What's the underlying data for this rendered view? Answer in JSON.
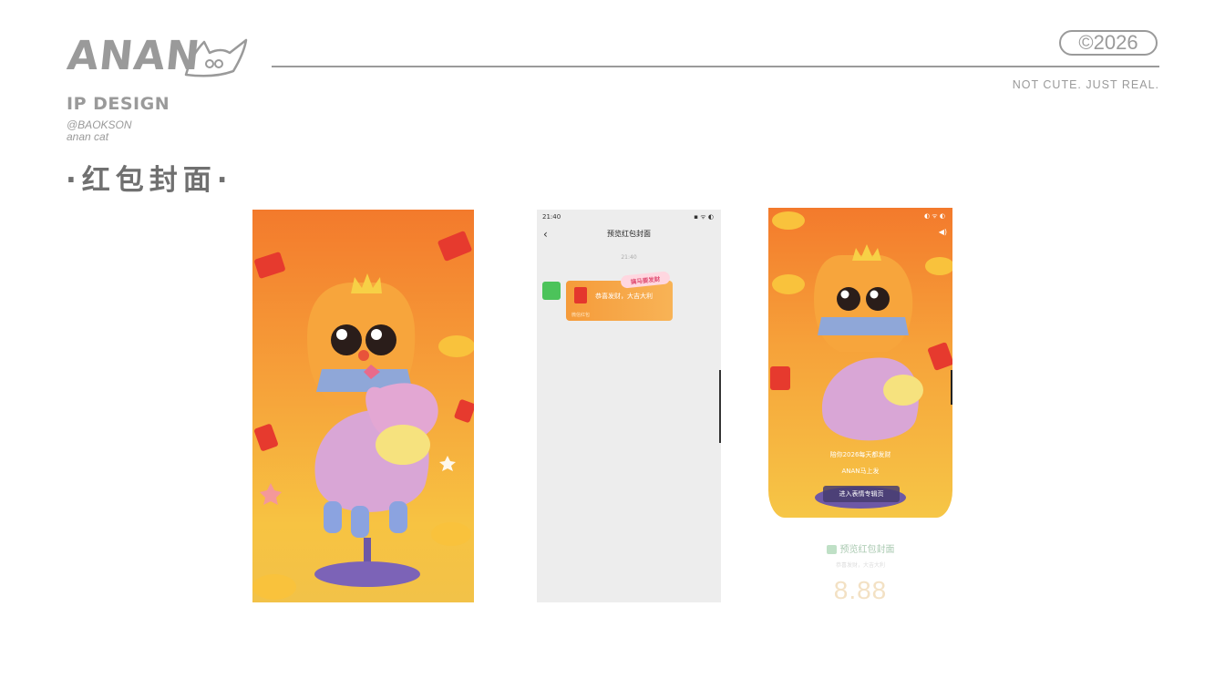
{
  "header": {
    "brand": "ANAN",
    "year": "©2026",
    "tagline": "NOT CUTE. JUST REAL.",
    "ip_title": "IP DESIGN",
    "handle": "@BAOKSON",
    "subhandle": "anan cat",
    "section_title": "·红包封面·"
  },
  "chat_preview": {
    "status_time": "21:40",
    "status_right": "▪ ᯤ ◐",
    "title": "预览红包封面",
    "time": "21:40",
    "envelope_text": "恭喜发财，大吉大利",
    "envelope_sub": "微信红包",
    "badge": "搞马要发财"
  },
  "cover": {
    "caption": "陪你2026每天都发财",
    "name": "ANAN马上发",
    "button": "进入表情专辑页",
    "status_right": "◐ ᯤ ◐",
    "speaker": "◀)"
  },
  "preview_below": {
    "label": "预览红包封面",
    "sub": "恭喜发财，大吉大利",
    "amount": "8.88"
  },
  "colors": {
    "orange_top": "#f37a2c",
    "orange_mid": "#f6a23a",
    "yellow_bottom": "#f7c342",
    "wechat_green": "#4cc35a",
    "header_gray": "#9a9a9a"
  }
}
